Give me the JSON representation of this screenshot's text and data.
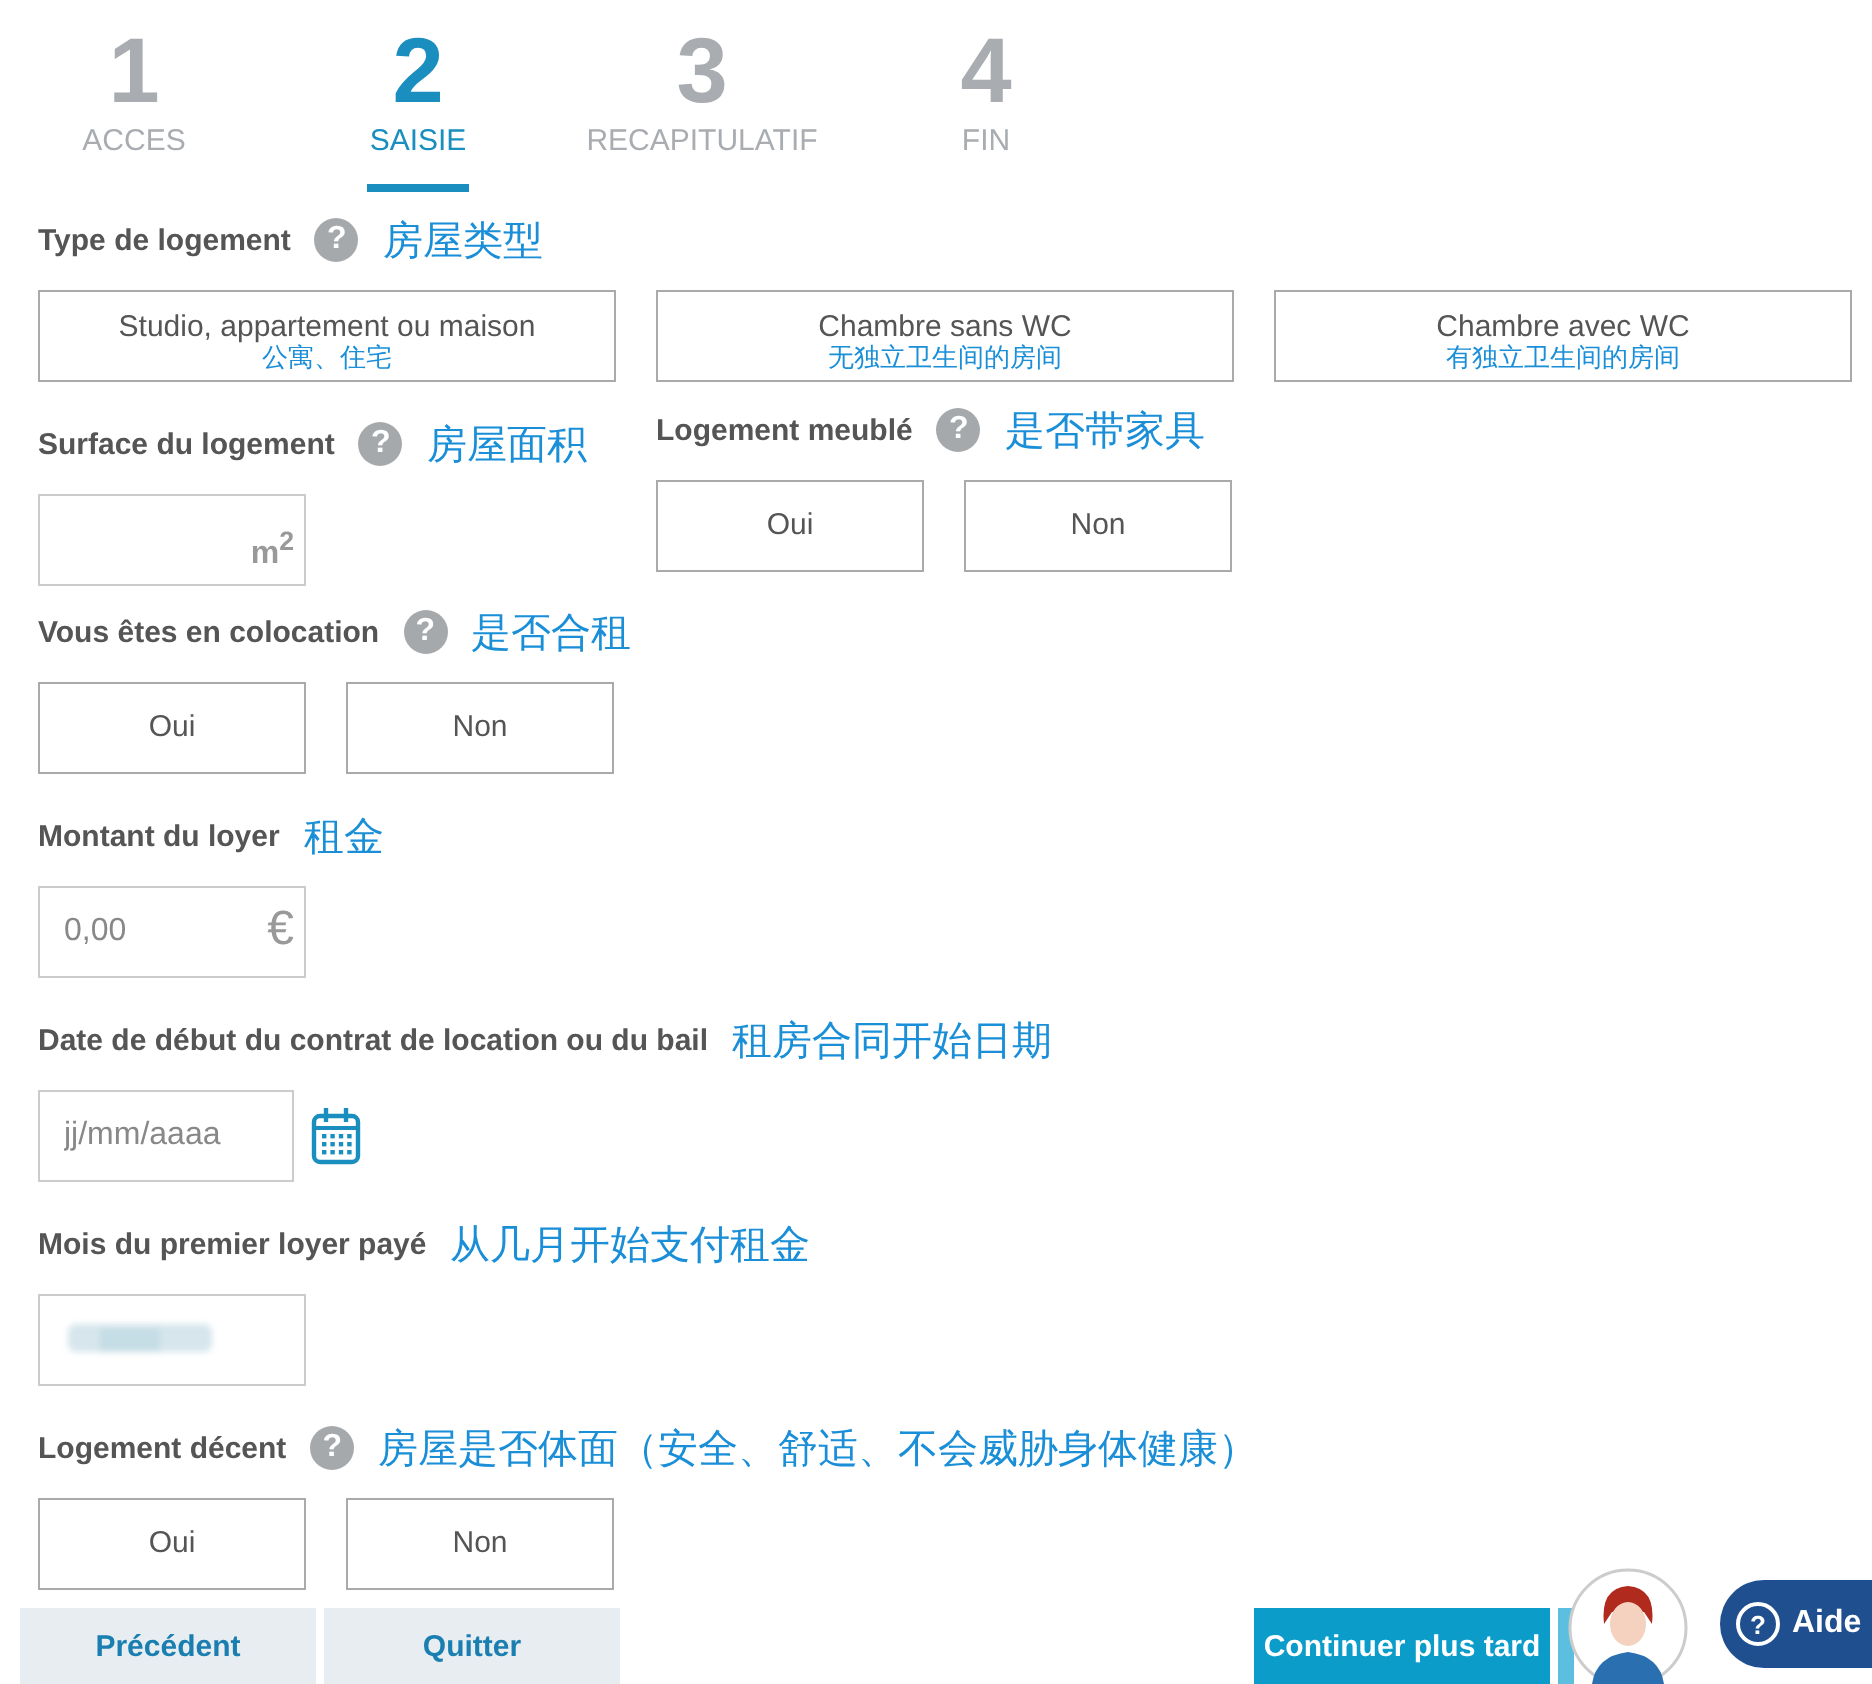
{
  "steps": [
    {
      "number": "1",
      "label": "ACCES",
      "selected": false
    },
    {
      "number": "2",
      "label": "SAISIE",
      "selected": true
    },
    {
      "number": "3",
      "label": "RECAPITULATIF",
      "selected": false
    },
    {
      "number": "4",
      "label": "FIN",
      "selected": false
    }
  ],
  "fields": [
    {
      "kind": "options",
      "label": "Type de logement",
      "help": "?",
      "note": "房屋类型",
      "options": [
        {
          "label": "Studio, appartement ou maison",
          "note": "公寓、住宅",
          "selected": false
        },
        {
          "label": "Chambre sans WC",
          "note": "无独立卫生间的房间",
          "selected": false
        },
        {
          "label": "Chambre avec WC",
          "note": "有独立卫生间的房间",
          "selected": false
        }
      ]
    },
    {
      "kind": "pair",
      "fields": [
        {
          "kind": "input",
          "label": "Surface du logement",
          "help": "?",
          "note": "房屋面积",
          "unit": "m$^{2}$"
        },
        {
          "kind": "options",
          "label": "Logement meublé",
          "help": "?",
          "note": "是否带家具",
          "options": [
            {
              "label": "Oui",
              "selected": false
            },
            {
              "label": "Non",
              "selected": false
            }
          ]
        }
      ]
    },
    {
      "kind": "options",
      "label": "Vous êtes en colocation",
      "help": "?",
      "note": "是否合租",
      "options": [
        {
          "label": "Oui",
          "selected": false
        },
        {
          "label": "Non",
          "selected": false
        }
      ]
    },
    {
      "kind": "input",
      "label": "Montant du loyer",
      "note": "租金",
      "placeholder": "0,00",
      "unit": "€"
    },
    {
      "kind": "date",
      "label": "Date de début du contrat de location ou du bail",
      "note": "租房合同开始日期",
      "placeholder": "jj/mm/aaaa"
    },
    {
      "kind": "blurred",
      "label": "Mois du premier loyer payé",
      "note": "从几月开始支付租金"
    },
    {
      "kind": "options",
      "label": "Logement décent",
      "help": "?",
      "note": "房屋是否体面（安全、舒适、不会威胁身体健康）",
      "options": [
        {
          "label": "Oui",
          "selected": false
        },
        {
          "label": "Non",
          "selected": false
        }
      ]
    }
  ],
  "footer": {
    "left": [
      "Précédent",
      "Quitter"
    ],
    "right": [
      {
        "label": "Continuer plus tard",
        "kind": "primary"
      },
      {
        "kind": "light"
      }
    ]
  },
  "aide": {
    "icon": "?",
    "label": "Aide"
  }
}
